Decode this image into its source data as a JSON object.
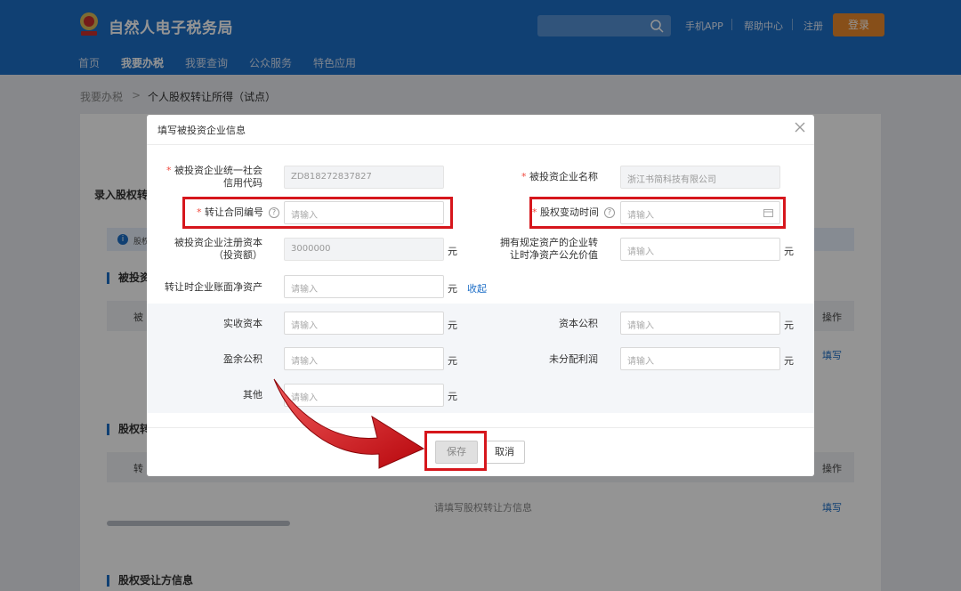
{
  "header": {
    "title": "自然人电子税务局",
    "links": {
      "app": "手机APP",
      "help": "帮助中心",
      "register": "注册"
    },
    "login_label": "登录",
    "nav": [
      "首页",
      "我要办税",
      "我要查询",
      "公众服务",
      "特色应用"
    ],
    "active_nav": "我要办税"
  },
  "breadcrumb": {
    "parent": "我要办税",
    "separator": ">",
    "current": "个人股权转让所得（试点）"
  },
  "background": {
    "panel_title": "录入股权转",
    "info_text": "股权",
    "section_investee": "被投资",
    "table1_col1": "被",
    "table1_op": "操作",
    "table1_fill": "填写",
    "section_transferor": "股权转",
    "table2_col1": "转",
    "table2_op": "操作",
    "table2_fill": "填写",
    "table2_empty": "请填写股权转让方信息",
    "section_transferee": "股权受让方信息"
  },
  "modal": {
    "title": "填写被投资企业信息",
    "fields": {
      "credit_code": {
        "label_line1": "被投资企业统一社会",
        "label_line2": "信用代码",
        "value": "ZD818272837827"
      },
      "company_name": {
        "label": "被投资企业名称",
        "value": "浙江书简科技有限公司"
      },
      "contract_no": {
        "label": "转让合同编号",
        "placeholder": "请输入"
      },
      "change_time": {
        "label": "股权变动时间",
        "placeholder": "请输入"
      },
      "reg_capital": {
        "label_line1": "被投资企业注册资本",
        "label_line2": "（投资额）",
        "value": "3000000",
        "unit": "元"
      },
      "fair_value": {
        "label_line1": "拥有规定资产的企业转",
        "label_line2": "让时净资产公允价值",
        "placeholder": "请输入",
        "unit": "元"
      },
      "net_assets": {
        "label": "转让时企业账面净资产",
        "placeholder": "请输入",
        "unit": "元",
        "collapse": "收起"
      },
      "paid_capital": {
        "label": "实收资本",
        "placeholder": "请输入",
        "unit": "元"
      },
      "capital_reserve": {
        "label": "资本公积",
        "placeholder": "请输入",
        "unit": "元"
      },
      "surplus_reserve": {
        "label": "盈余公积",
        "placeholder": "请输入",
        "unit": "元"
      },
      "undistributed_profit": {
        "label": "未分配利润",
        "placeholder": "请输入",
        "unit": "元"
      },
      "other": {
        "label": "其他",
        "placeholder": "请输入",
        "unit": "元"
      }
    },
    "required_mark": "*",
    "help_glyph": "?",
    "save_label": "保存",
    "cancel_label": "取消"
  },
  "colors": {
    "brand": "#1d6ec7",
    "highlight": "#d6161c",
    "login": "#e8892c"
  },
  "icons": [
    "tax-emblem-icon",
    "search-icon",
    "close-icon",
    "help-icon",
    "calendar-icon",
    "info-icon",
    "red-arrow-icon"
  ]
}
